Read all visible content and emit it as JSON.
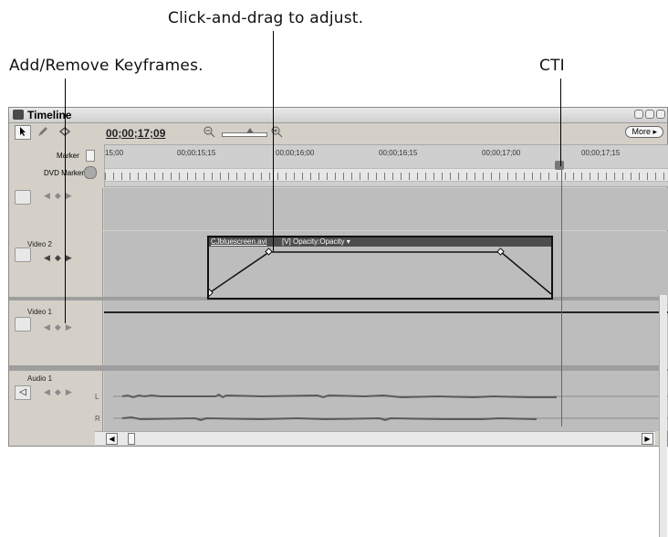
{
  "callouts": {
    "adjust": "Click-and-drag to adjust.",
    "keyframes": "Add/Remove Keyframes.",
    "cti": "CTI"
  },
  "panel": {
    "title": "Timeline",
    "timecode": "00;00;17;09",
    "more_button": "More ▸"
  },
  "ruler": {
    "marker_label": "Marker",
    "dvd_marker_label": "DVD Marker",
    "time_labels": [
      "15;00",
      "00;00;15;15",
      "00;00;16;00",
      "00;00;16;15",
      "00;00;17;00",
      "00;00;17;15"
    ]
  },
  "tracks": {
    "video2": "Video 2",
    "video1": "Video 1",
    "audio1": "Audio 1",
    "channel_left": "L",
    "channel_right": "R"
  },
  "clip": {
    "name": "CJbluescreen.avi",
    "property": "[V] Opacity:Opacity ▾"
  },
  "icons": {
    "selection": "arrow-icon",
    "zoom_out": "zoom-out-icon",
    "zoom_in": "zoom-in-icon"
  }
}
